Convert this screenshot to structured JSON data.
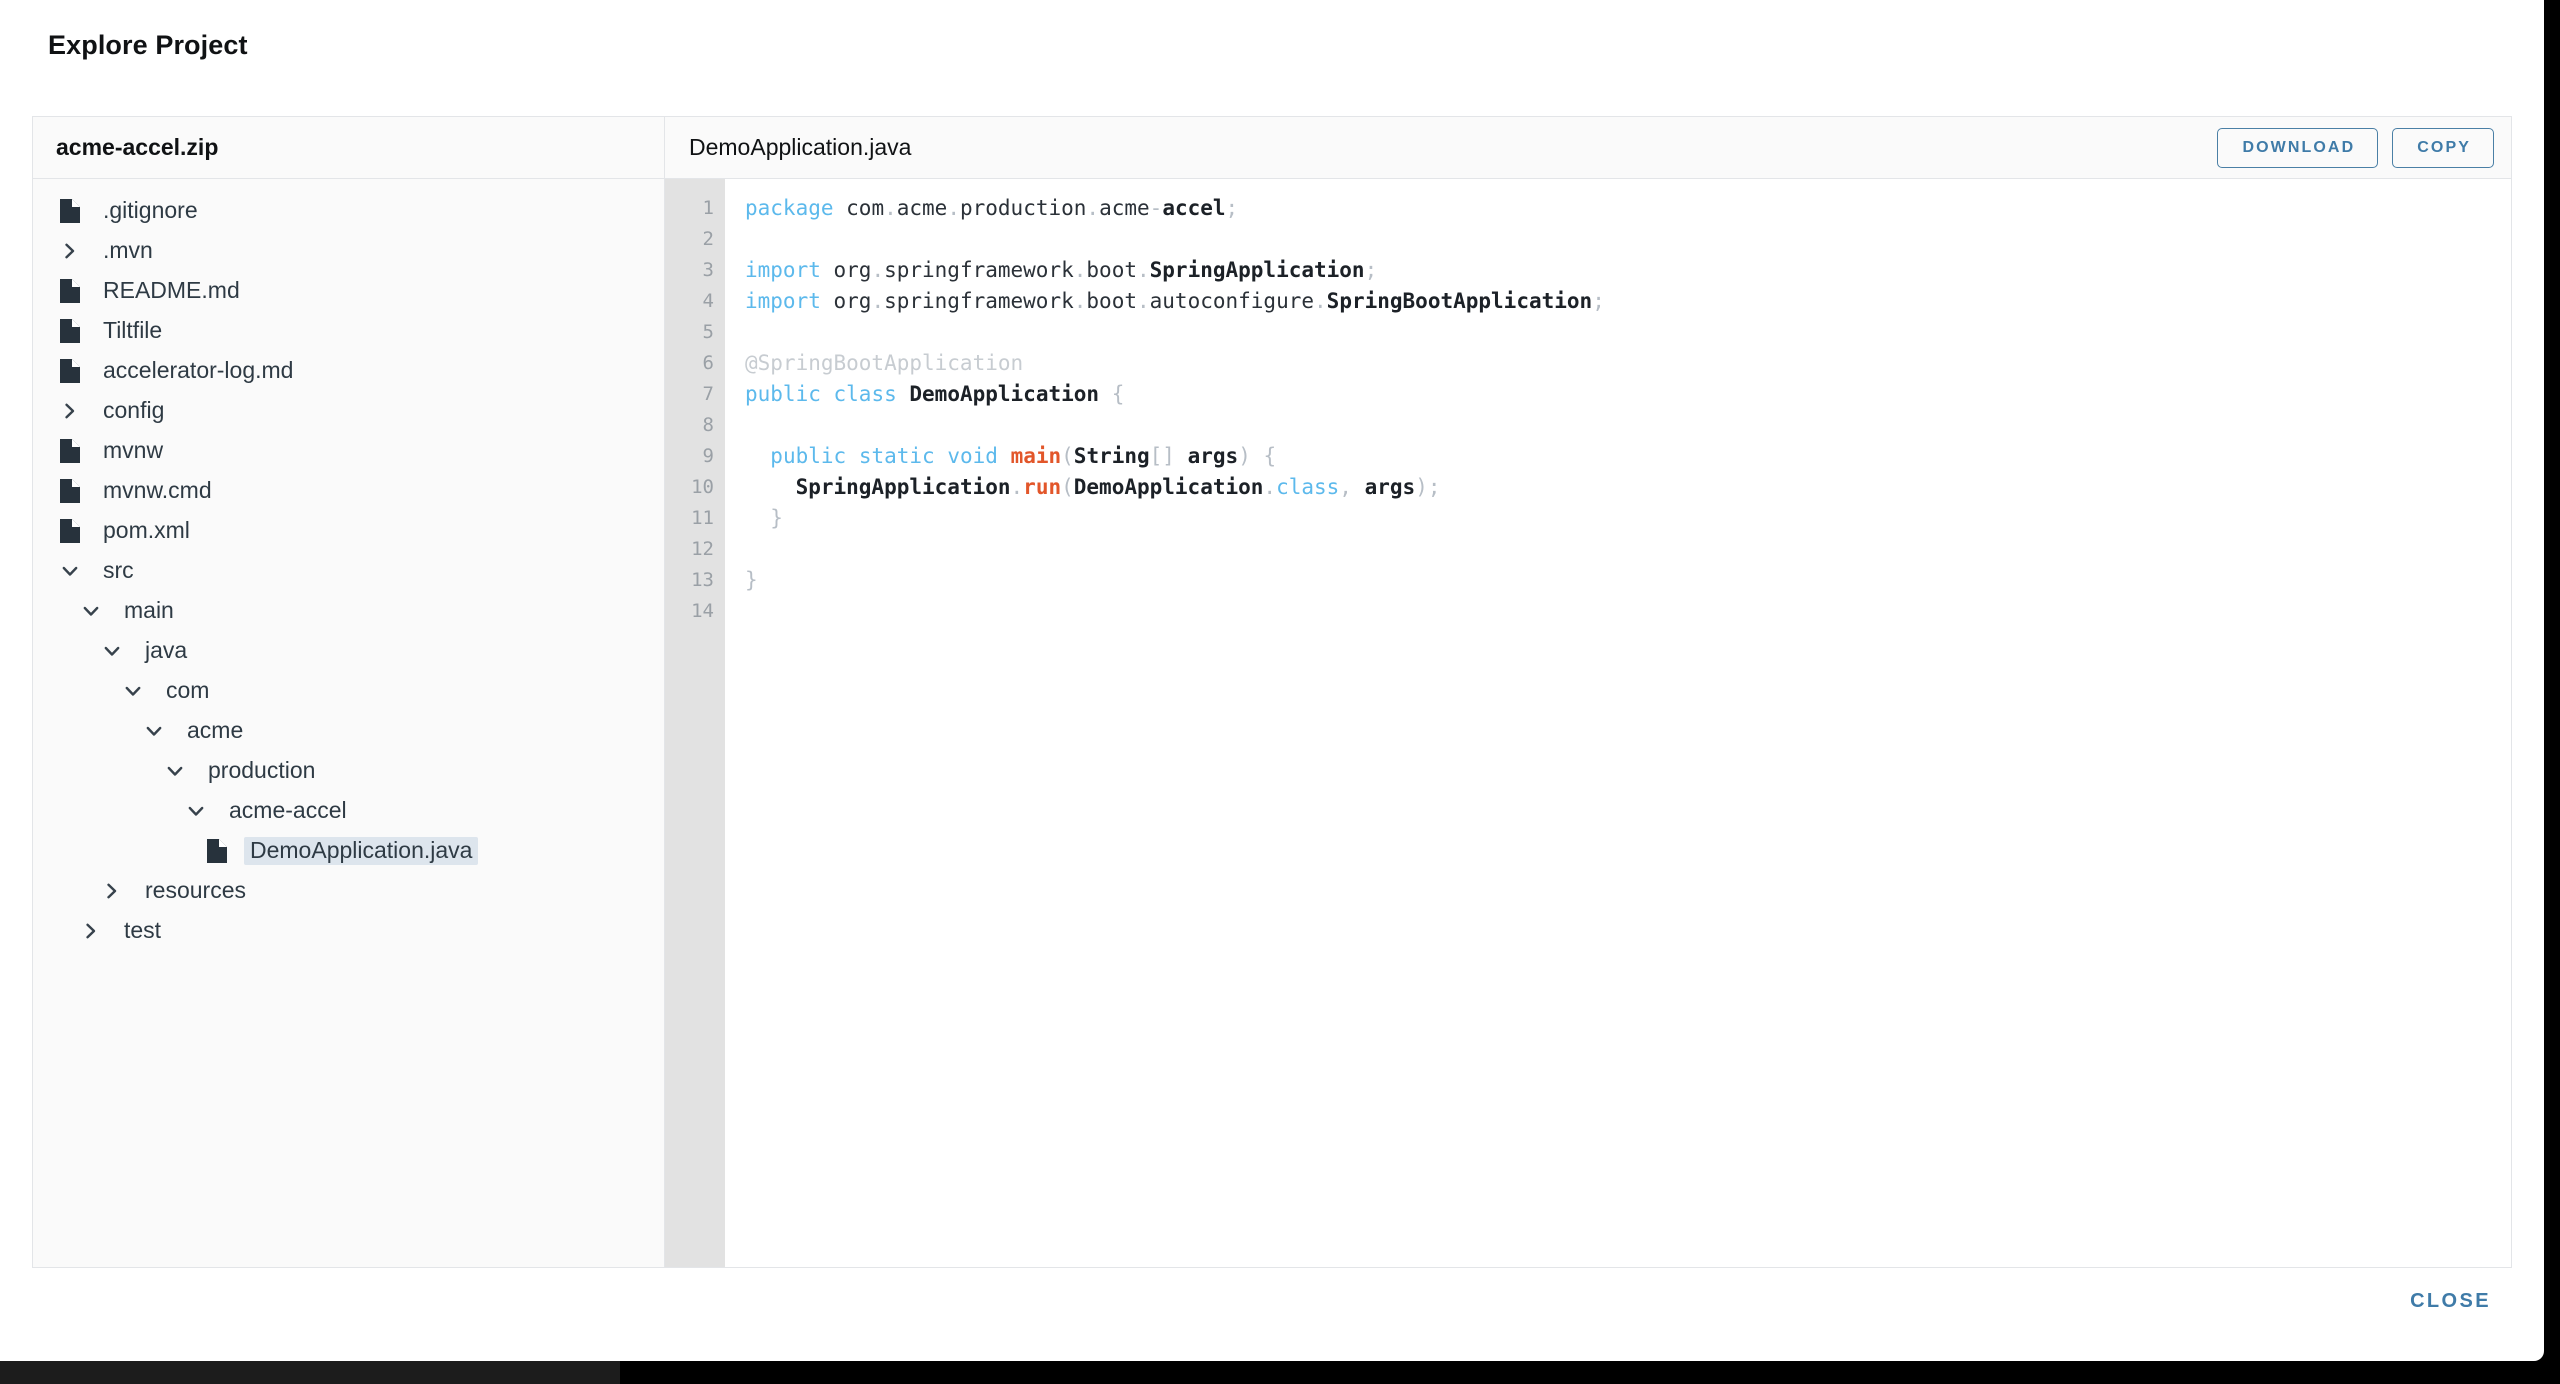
{
  "dialog": {
    "title": "Explore Project",
    "close_label": "CLOSE"
  },
  "tree_panel": {
    "header": "acme-accel.zip",
    "items": [
      {
        "label": ".gitignore",
        "depth": 0,
        "kind": "file"
      },
      {
        "label": ".mvn",
        "depth": 0,
        "kind": "folder-collapsed"
      },
      {
        "label": "README.md",
        "depth": 0,
        "kind": "file"
      },
      {
        "label": "Tiltfile",
        "depth": 0,
        "kind": "file"
      },
      {
        "label": "accelerator-log.md",
        "depth": 0,
        "kind": "file"
      },
      {
        "label": "config",
        "depth": 0,
        "kind": "folder-collapsed"
      },
      {
        "label": "mvnw",
        "depth": 0,
        "kind": "file"
      },
      {
        "label": "mvnw.cmd",
        "depth": 0,
        "kind": "file"
      },
      {
        "label": "pom.xml",
        "depth": 0,
        "kind": "file"
      },
      {
        "label": "src",
        "depth": 0,
        "kind": "folder-expanded"
      },
      {
        "label": "main",
        "depth": 1,
        "kind": "folder-expanded"
      },
      {
        "label": "java",
        "depth": 2,
        "kind": "folder-expanded"
      },
      {
        "label": "com",
        "depth": 3,
        "kind": "folder-expanded"
      },
      {
        "label": "acme",
        "depth": 4,
        "kind": "folder-expanded"
      },
      {
        "label": "production",
        "depth": 5,
        "kind": "folder-expanded"
      },
      {
        "label": "acme-accel",
        "depth": 6,
        "kind": "folder-expanded"
      },
      {
        "label": "DemoApplication.java",
        "depth": 7,
        "kind": "file",
        "selected": true
      },
      {
        "label": "resources",
        "depth": 2,
        "kind": "folder-collapsed"
      },
      {
        "label": "test",
        "depth": 1,
        "kind": "folder-collapsed"
      }
    ]
  },
  "code_panel": {
    "filename": "DemoApplication.java",
    "download_label": "DOWNLOAD",
    "copy_label": "COPY",
    "line_numbers": [
      1,
      2,
      3,
      4,
      5,
      6,
      7,
      8,
      9,
      10,
      11,
      12,
      13,
      14
    ],
    "lines": [
      [
        {
          "t": "package",
          "c": "kw"
        },
        {
          "t": " com",
          "c": "plain"
        },
        {
          "t": ".",
          "c": "punc"
        },
        {
          "t": "acme",
          "c": "plain"
        },
        {
          "t": ".",
          "c": "punc"
        },
        {
          "t": "production",
          "c": "plain"
        },
        {
          "t": ".",
          "c": "punc"
        },
        {
          "t": "acme",
          "c": "plain"
        },
        {
          "t": "-",
          "c": "punc"
        },
        {
          "t": "accel",
          "c": "type"
        },
        {
          "t": ";",
          "c": "punc"
        }
      ],
      [],
      [
        {
          "t": "import",
          "c": "kw"
        },
        {
          "t": " org",
          "c": "plain"
        },
        {
          "t": ".",
          "c": "punc"
        },
        {
          "t": "springframework",
          "c": "plain"
        },
        {
          "t": ".",
          "c": "punc"
        },
        {
          "t": "boot",
          "c": "plain"
        },
        {
          "t": ".",
          "c": "punc"
        },
        {
          "t": "SpringApplication",
          "c": "type"
        },
        {
          "t": ";",
          "c": "punc"
        }
      ],
      [
        {
          "t": "import",
          "c": "kw"
        },
        {
          "t": " org",
          "c": "plain"
        },
        {
          "t": ".",
          "c": "punc"
        },
        {
          "t": "springframework",
          "c": "plain"
        },
        {
          "t": ".",
          "c": "punc"
        },
        {
          "t": "boot",
          "c": "plain"
        },
        {
          "t": ".",
          "c": "punc"
        },
        {
          "t": "autoconfigure",
          "c": "plain"
        },
        {
          "t": ".",
          "c": "punc"
        },
        {
          "t": "SpringBootApplication",
          "c": "type"
        },
        {
          "t": ";",
          "c": "punc"
        }
      ],
      [],
      [
        {
          "t": "@SpringBootApplication",
          "c": "ann"
        }
      ],
      [
        {
          "t": "public",
          "c": "kw"
        },
        {
          "t": " ",
          "c": "plain"
        },
        {
          "t": "class",
          "c": "kw"
        },
        {
          "t": " ",
          "c": "plain"
        },
        {
          "t": "DemoApplication",
          "c": "type"
        },
        {
          "t": " ",
          "c": "plain"
        },
        {
          "t": "{",
          "c": "punc"
        }
      ],
      [],
      [
        {
          "t": "  ",
          "c": "plain"
        },
        {
          "t": "public",
          "c": "kw"
        },
        {
          "t": " ",
          "c": "plain"
        },
        {
          "t": "static",
          "c": "kw"
        },
        {
          "t": " ",
          "c": "plain"
        },
        {
          "t": "void",
          "c": "kw"
        },
        {
          "t": " ",
          "c": "plain"
        },
        {
          "t": "main",
          "c": "fn"
        },
        {
          "t": "(",
          "c": "punc"
        },
        {
          "t": "String",
          "c": "type"
        },
        {
          "t": "[]",
          "c": "punc"
        },
        {
          "t": " ",
          "c": "plain"
        },
        {
          "t": "args",
          "c": "type"
        },
        {
          "t": ")",
          "c": "punc"
        },
        {
          "t": " ",
          "c": "plain"
        },
        {
          "t": "{",
          "c": "punc"
        }
      ],
      [
        {
          "t": "    ",
          "c": "plain"
        },
        {
          "t": "SpringApplication",
          "c": "type"
        },
        {
          "t": ".",
          "c": "punc"
        },
        {
          "t": "run",
          "c": "fn"
        },
        {
          "t": "(",
          "c": "punc"
        },
        {
          "t": "DemoApplication",
          "c": "type"
        },
        {
          "t": ".",
          "c": "punc"
        },
        {
          "t": "class",
          "c": "kw"
        },
        {
          "t": ",",
          "c": "punc"
        },
        {
          "t": " ",
          "c": "plain"
        },
        {
          "t": "args",
          "c": "type"
        },
        {
          "t": ")",
          "c": "punc"
        },
        {
          "t": ";",
          "c": "punc"
        }
      ],
      [
        {
          "t": "  ",
          "c": "plain"
        },
        {
          "t": "}",
          "c": "punc"
        }
      ],
      [],
      [
        {
          "t": "}",
          "c": "punc"
        }
      ],
      []
    ]
  },
  "colors": {
    "accent": "#3f7ba8",
    "selected_row": "#dde5ed",
    "gutter_bg": "#e2e2e2",
    "keyword": "#5cb9ec",
    "function": "#e2562a",
    "annotation": "#c7ccd1",
    "punctuation": "#b7bec6",
    "icon": "#27323c"
  }
}
